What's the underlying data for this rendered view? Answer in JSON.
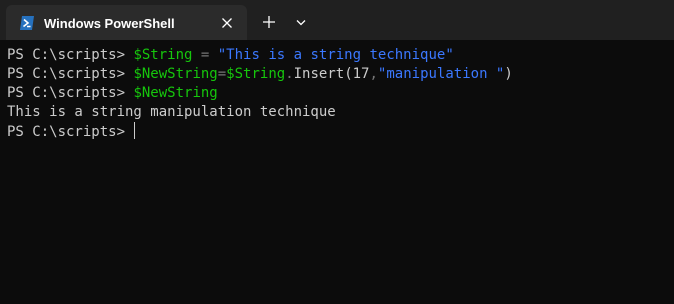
{
  "tab": {
    "title": "Windows PowerShell",
    "icon": "powershell-icon",
    "close_icon": "close-icon"
  },
  "toolbar": {
    "new_tab_icon": "plus-icon",
    "dropdown_icon": "chevron-down-icon"
  },
  "colors": {
    "tabbar_bg": "#202020",
    "tab_bg": "#2b2b2b",
    "terminal_bg": "#0c0c0c",
    "text": "#cccccc",
    "variable": "#16c60c",
    "operator": "#767676",
    "string": "#3b78ff"
  },
  "terminal": {
    "lines": [
      {
        "prompt": "PS C:\\scripts> ",
        "var": "$String",
        "op": " = ",
        "str": "\"This is a string technique\""
      },
      {
        "prompt": "PS C:\\scripts> ",
        "var1": "$NewString",
        "op1": "=",
        "var2": "$String",
        "op2": ".",
        "method": "Insert(17",
        "comma": ",",
        "str": "\"manipulation \"",
        "close": ")"
      },
      {
        "prompt": "PS C:\\scripts> ",
        "var": "$NewString"
      },
      {
        "output": "This is a string manipulation technique"
      },
      {
        "prompt": "PS C:\\scripts> "
      }
    ]
  }
}
